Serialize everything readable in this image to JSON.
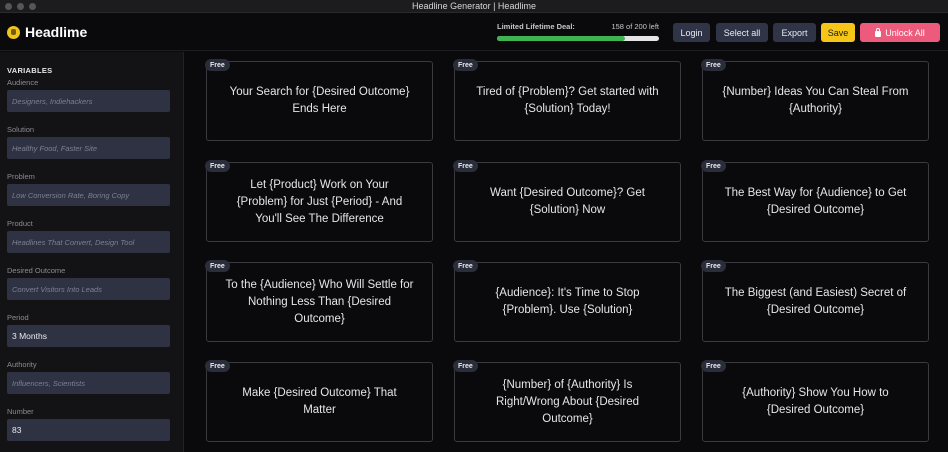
{
  "window": {
    "title": "Headline Generator | Headlime"
  },
  "app": {
    "name": "Headlime"
  },
  "deal": {
    "label": "Limited Lifetime Deal:",
    "count": "158 of 200 left",
    "progress": 0.79
  },
  "toolbar": {
    "login": "Login",
    "select_all": "Select all",
    "export": "Export",
    "save": "Save",
    "unlock": "Unlock All"
  },
  "sidebar": {
    "heading": "VARIABLES",
    "fields": [
      {
        "label": "Audience",
        "placeholder": "Designers, Indiehackers",
        "value": ""
      },
      {
        "label": "Solution",
        "placeholder": "Healthy Food, Faster Site",
        "value": ""
      },
      {
        "label": "Problem",
        "placeholder": "Low Conversion Rate, Boring Copy",
        "value": ""
      },
      {
        "label": "Product",
        "placeholder": "Headlines That Convert, Design Tool",
        "value": ""
      },
      {
        "label": "Desired Outcome",
        "placeholder": "Convert Visitors Into Leads",
        "value": ""
      },
      {
        "label": "Period",
        "placeholder": "",
        "value": "3 Months"
      },
      {
        "label": "Authority",
        "placeholder": "Influencers, Scientists",
        "value": ""
      },
      {
        "label": "Number",
        "placeholder": "",
        "value": "83"
      }
    ]
  },
  "cards": [
    {
      "badge": "Free",
      "text": "Your Search for {Desired Outcome} Ends Here"
    },
    {
      "badge": "Free",
      "text": "Tired of {Problem}? Get started with {Solution} Today!"
    },
    {
      "badge": "Free",
      "text": "{Number} Ideas You Can Steal From {Authority}"
    },
    {
      "badge": "Free",
      "text": "Let {Product} Work on Your {Problem} for Just {Period} - And You'll See The Difference"
    },
    {
      "badge": "Free",
      "text": "Want {Desired Outcome}? Get {Solution} Now"
    },
    {
      "badge": "Free",
      "text": "The Best Way for {Audience} to Get {Desired Outcome}"
    },
    {
      "badge": "Free",
      "text": "To the {Audience} Who Will Settle for Nothing Less Than {Desired Outcome}"
    },
    {
      "badge": "Free",
      "text": "{Audience}: It's Time to Stop {Problem}. Use {Solution}"
    },
    {
      "badge": "Free",
      "text": "The Biggest (and Easiest) Secret of {Desired Outcome}"
    },
    {
      "badge": "Free",
      "text": "Make {Desired Outcome} That Matter"
    },
    {
      "badge": "Free",
      "text": "{Number} of {Authority} Is Right/Wrong About {Desired Outcome}"
    },
    {
      "badge": "Free",
      "text": "{Authority} Show You How to {Desired Outcome}"
    }
  ]
}
